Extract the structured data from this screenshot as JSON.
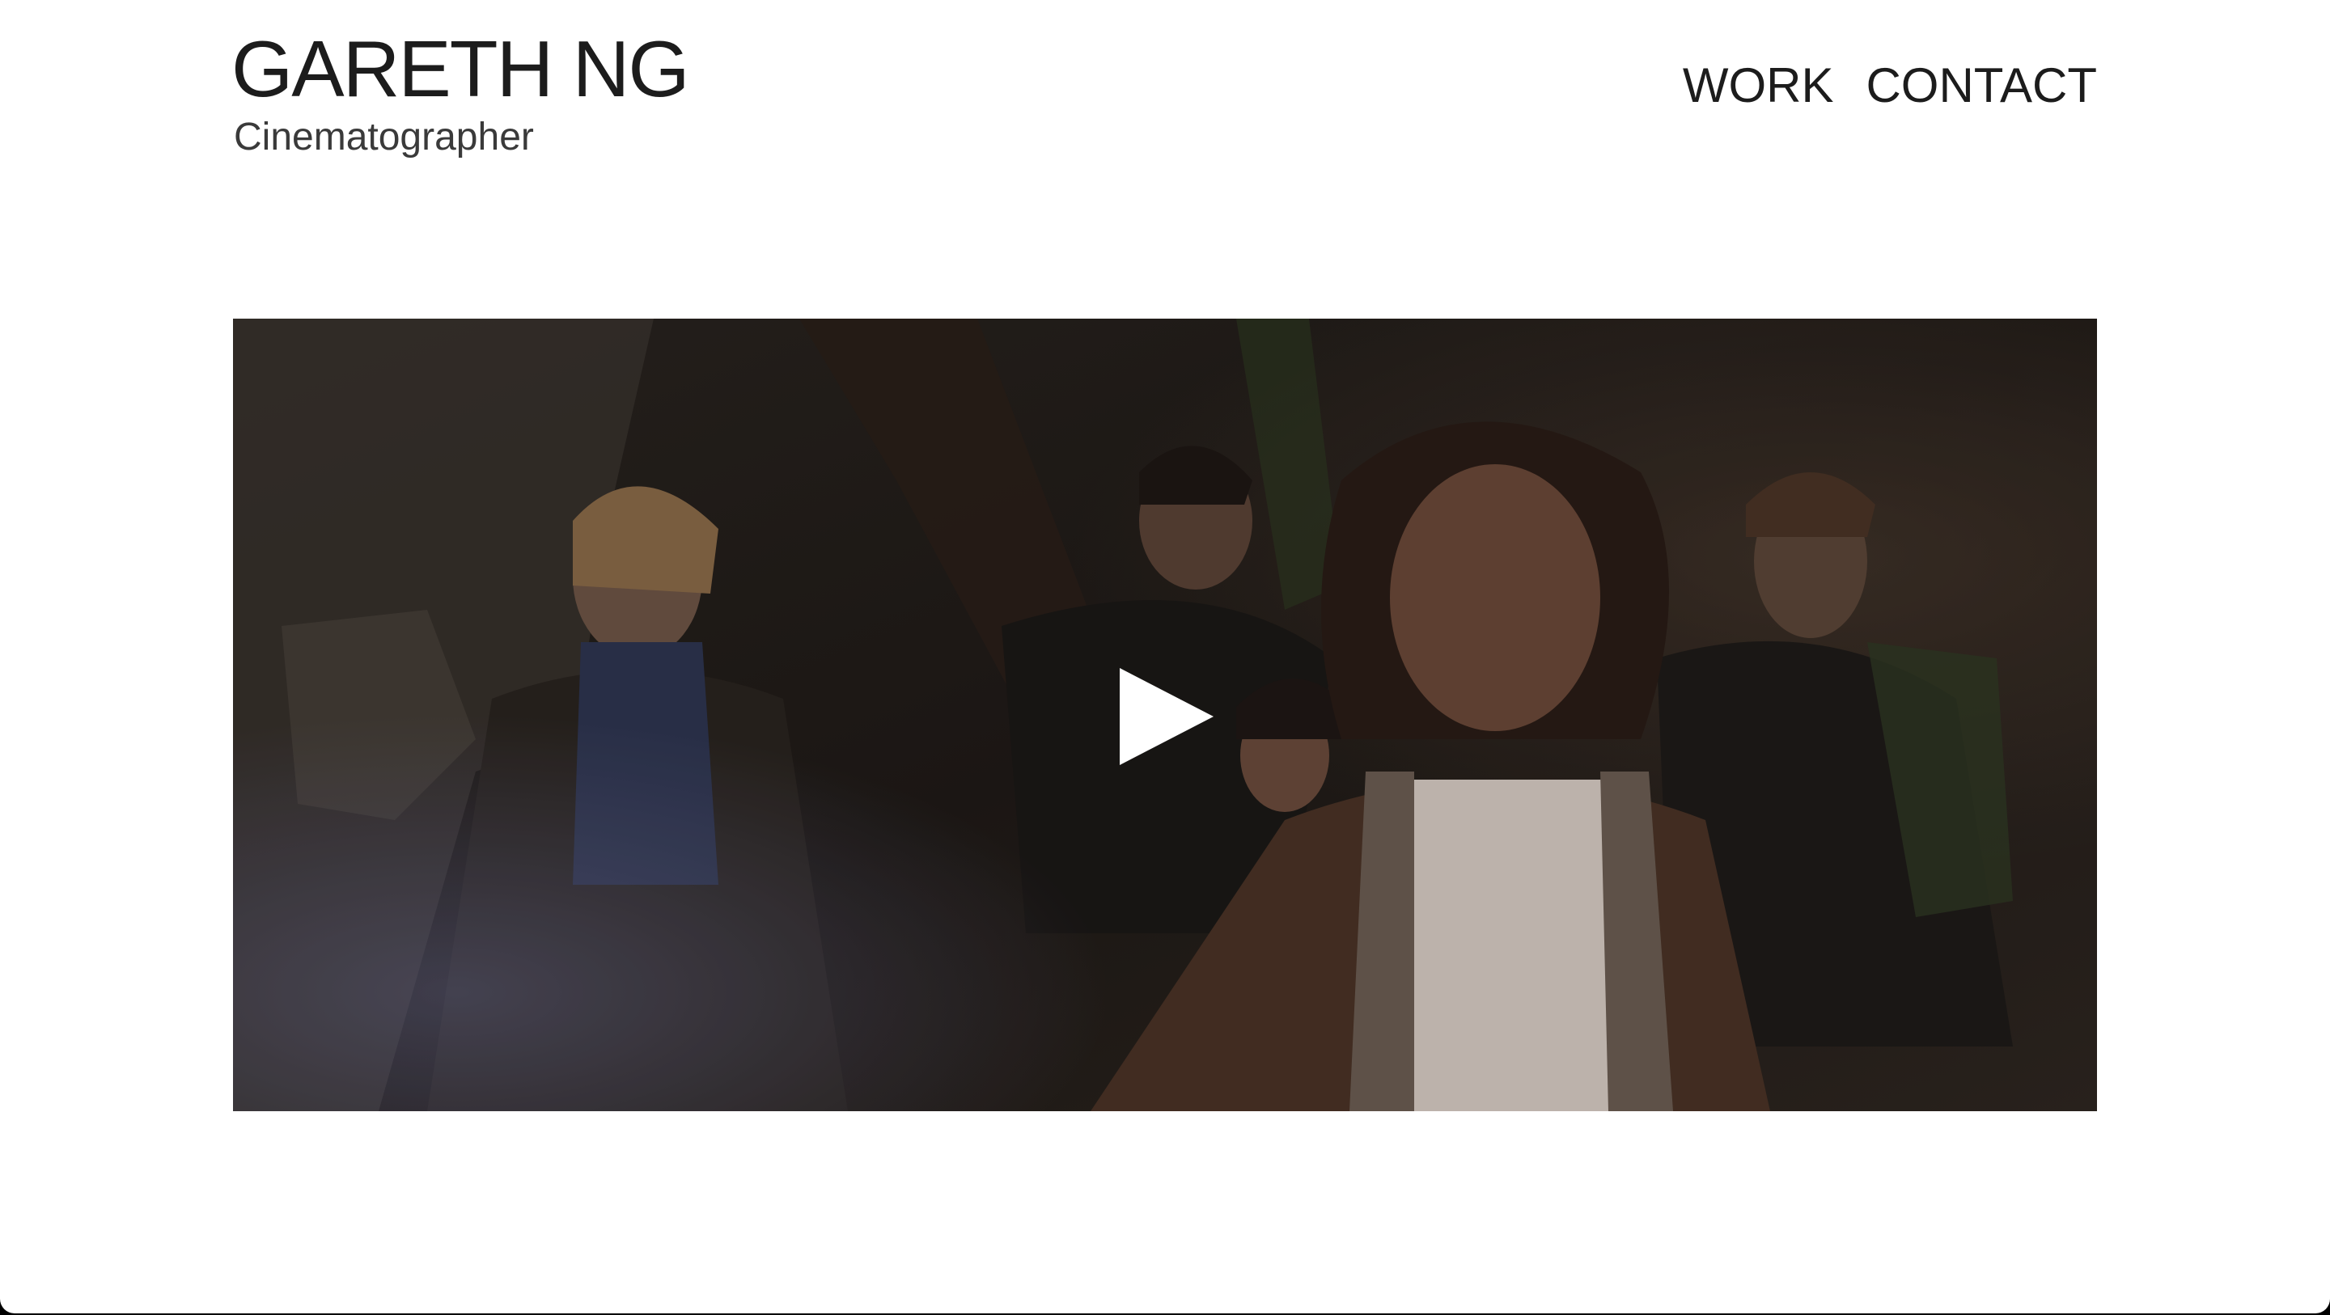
{
  "header": {
    "title": "GARETH NG",
    "subtitle": "Cinematographer"
  },
  "nav": {
    "items": [
      {
        "label": "WORK"
      },
      {
        "label": "CONTACT"
      }
    ]
  },
  "video": {
    "play_icon": "play-icon"
  }
}
